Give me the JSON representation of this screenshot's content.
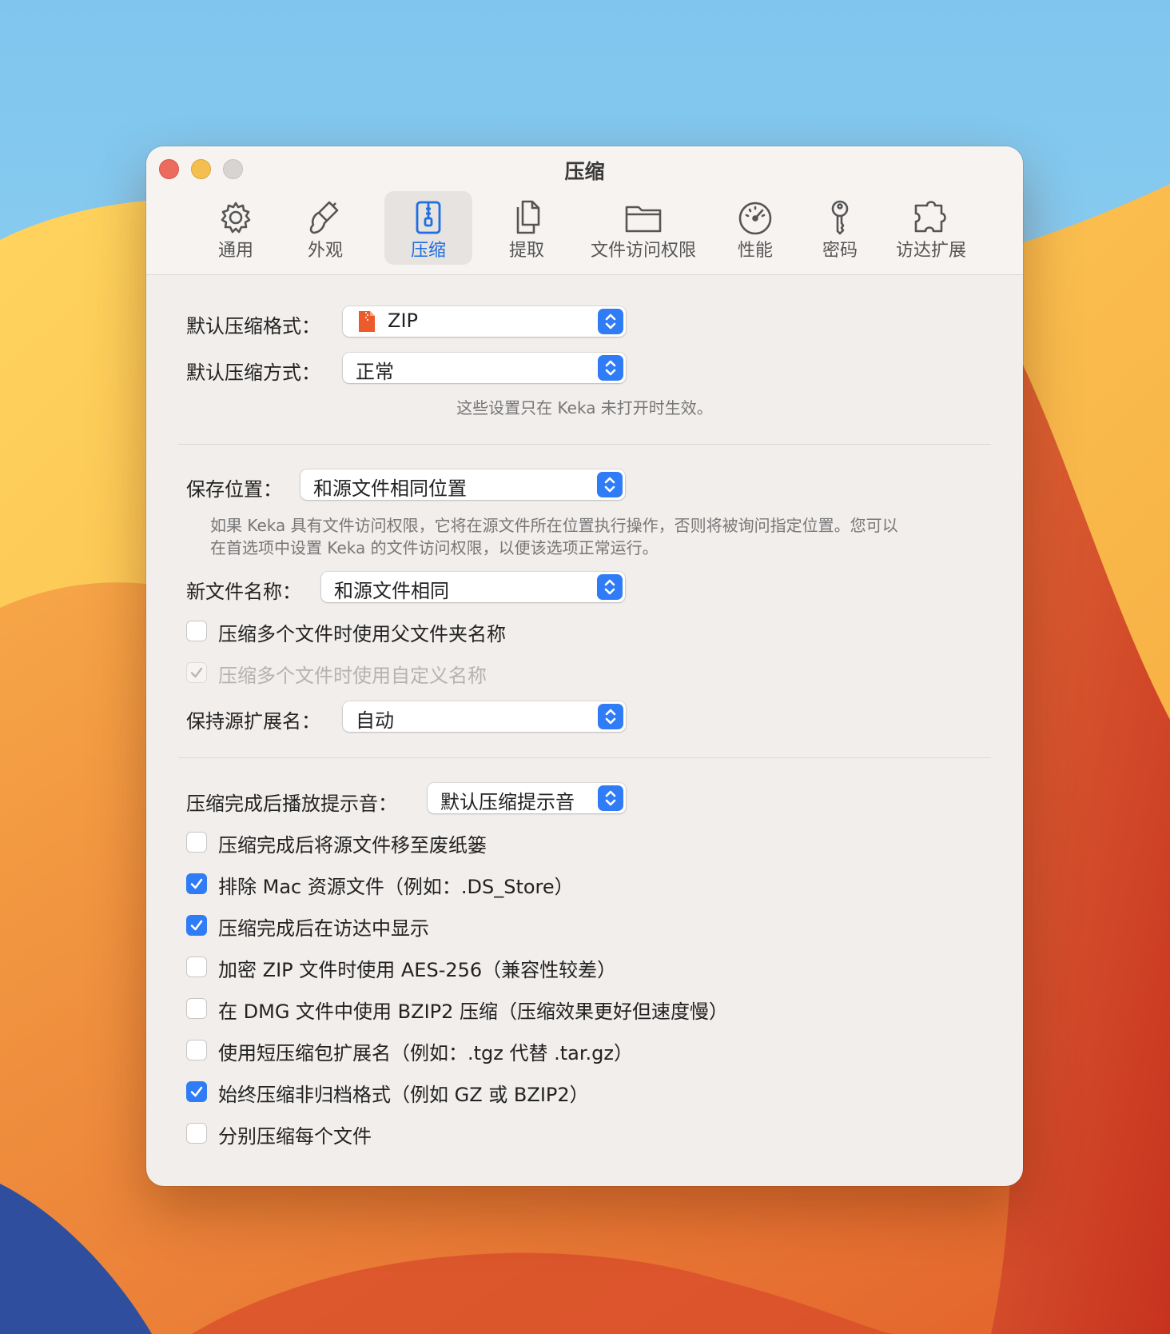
{
  "window": {
    "title": "压缩"
  },
  "tabs": [
    {
      "label": "通用",
      "icon": "gear-icon",
      "active": false
    },
    {
      "label": "外观",
      "icon": "brush-icon",
      "active": false
    },
    {
      "label": "压缩",
      "icon": "archive-icon",
      "active": true
    },
    {
      "label": "提取",
      "icon": "documents-icon",
      "active": false
    },
    {
      "label": "文件访问权限",
      "icon": "folder-icon",
      "active": false
    },
    {
      "label": "性能",
      "icon": "gauge-icon",
      "active": false
    },
    {
      "label": "密码",
      "icon": "key-icon",
      "active": false
    },
    {
      "label": "访达扩展",
      "icon": "puzzle-icon",
      "active": false
    }
  ],
  "section1": {
    "format_label": "默认压缩格式：",
    "format_value": "ZIP",
    "method_label": "默认压缩方式：",
    "method_value": "正常",
    "note": "这些设置只在 Keka 未打开时生效。"
  },
  "section2": {
    "save_label": "保存位置：",
    "save_value": "和源文件相同位置",
    "save_note_line1": "如果 Keka 具有文件访问权限，它将在源文件所在位置执行操作，否则将被询问指定位置。您可以",
    "save_note_line2": "在首选项中设置 Keka 的文件访问权限，以便该选项正常运行。",
    "name_label": "新文件名称：",
    "name_value": "和源文件相同",
    "parent_folder_label": "压缩多个文件时使用父文件夹名称",
    "parent_folder_checked": false,
    "custom_name_label": "压缩多个文件时使用自定义名称",
    "custom_name_checked": true,
    "keep_ext_label": "保持源扩展名：",
    "keep_ext_value": "自动"
  },
  "section3": {
    "sound_label": "压缩完成后播放提示音：",
    "sound_value": "默认压缩提示音",
    "checkboxes": [
      {
        "label": "压缩完成后将源文件移至废纸篓",
        "checked": false
      },
      {
        "label": "排除 Mac 资源文件（例如：.DS_Store）",
        "checked": true
      },
      {
        "label": "压缩完成后在访达中显示",
        "checked": true
      },
      {
        "label": "加密 ZIP 文件时使用 AES-256（兼容性较差）",
        "checked": false
      },
      {
        "label": "在 DMG 文件中使用 BZIP2 压缩（压缩效果更好但速度慢）",
        "checked": false
      },
      {
        "label": "使用短压缩包扩展名（例如：.tgz 代替 .tar.gz）",
        "checked": false
      },
      {
        "label": "始终压缩非归档格式（例如 GZ 或 BZIP2）",
        "checked": true
      },
      {
        "label": "分别压缩每个文件",
        "checked": false
      }
    ]
  },
  "colors": {
    "accent": "#2f7cf6",
    "close": "#ed6a5e",
    "minimize": "#f5bf4f",
    "zoom": "#d8d4d2"
  }
}
